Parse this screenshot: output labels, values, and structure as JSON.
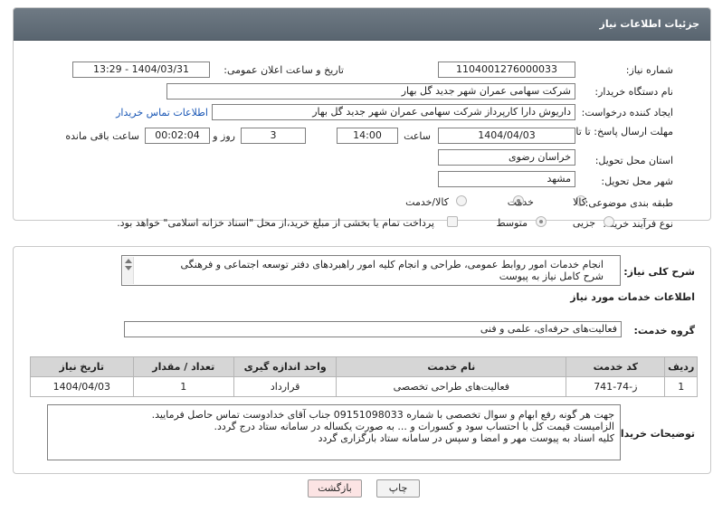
{
  "header": {
    "title": "جزئیات اطلاعات نیاز"
  },
  "fields": {
    "need_number_label": "شماره نیاز:",
    "need_number": "1104001276000033",
    "announce_label": "تاریخ و ساعت اعلان عمومی:",
    "announce_value": "1404/03/31 - 13:29",
    "buyer_org_label": "نام دستگاه خریدار:",
    "buyer_org": "شرکت سهامی عمران شهر جدید گل بهار",
    "creator_label": "ایجاد کننده درخواست:",
    "creator": "داریوش دارا کارپرداز شرکت سهامی عمران شهر جدید گل بهار",
    "contact_link": "اطلاعات تماس خریدار",
    "deadline_label": "مهلت ارسال پاسخ: تا تاریخ:",
    "deadline_date": "1404/04/03",
    "time_label": "ساعت",
    "deadline_time": "14:00",
    "days_value": "3",
    "days_label": "روز و",
    "remaining_time": "00:02:04",
    "remaining_label": "ساعت باقی مانده",
    "province_label": "استان محل تحویل:",
    "province": "خراسان رضوی",
    "city_label": "شهر محل تحویل:",
    "city": "مشهد",
    "category_label": "طبقه بندی موضوعی:",
    "category_options": [
      "کالا",
      "خدمت",
      "کالا/خدمت"
    ],
    "process_label": "نوع فرآیند خرید :",
    "process_options": [
      "جزیی",
      "متوسط"
    ],
    "payment_note": "پرداخت تمام یا بخشی از مبلغ خرید،از محل \"اسناد خزانه اسلامی\" خواهد بود."
  },
  "summary": {
    "label": "شرح کلی نیاز:",
    "text_line1": "انجام خدمات امور روابط عمومی، طراحی و انجام کلیه امور راهبردهای دفتر توسعه اجتماعی و فرهنگی",
    "text_line2": "شرح کامل نیاز به پیوست"
  },
  "services": {
    "section_title": "اطلاعات خدمات مورد نیاز",
    "group_label": "گروه خدمت:",
    "group_value": "فعالیت‌های حرفه‌ای، علمی و فنی",
    "columns": [
      "ردیف",
      "کد خدمت",
      "نام خدمت",
      "واحد اندازه گیری",
      "تعداد / مقدار",
      "تاریخ نیاز"
    ],
    "rows": [
      {
        "row": "1",
        "code": "ز-74-741",
        "name": "فعالیت‌های طراحی تخصصی",
        "unit": "قرارداد",
        "qty": "1",
        "date": "1404/04/03"
      }
    ]
  },
  "buyer_notes": {
    "label": "توضیحات خریدار:",
    "line1": "جهت هر گونه رفع ابهام و سوال تخصصی با شماره 09151098033 جناب آقای خدادوست تماس حاصل فرمایید.",
    "line2": "الزامیست قیمت کل با احتساب سود و کسورات و ... به صورت یکساله در سامانه ستاد درج گردد.",
    "line3": "کلیه اسناد به پیوست مهر و امضا و سپس در سامانه ستاد بارگزاری گردد"
  },
  "buttons": {
    "print": "چاپ",
    "back": "بازگشت"
  },
  "colors": {
    "header_bg": "#5f6a74",
    "back_button_bg": "#fce4e4",
    "link": "#1a57b5",
    "watermark": "#c62828"
  }
}
